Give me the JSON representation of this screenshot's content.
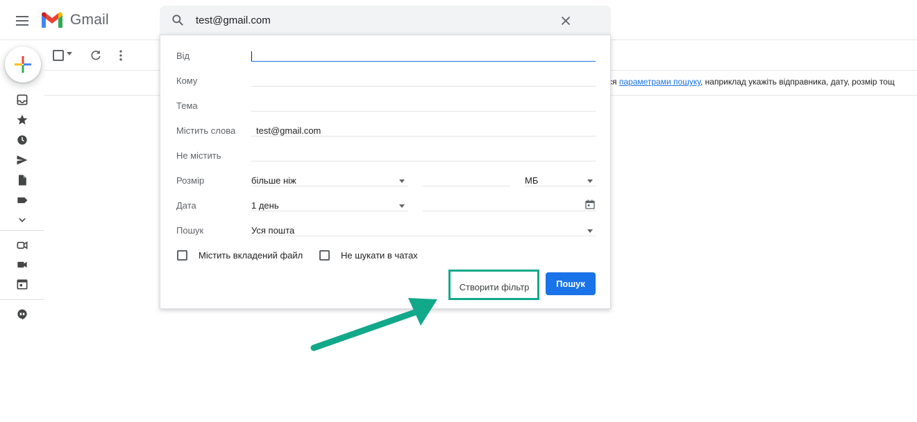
{
  "app": {
    "name": "Gmail"
  },
  "search": {
    "query": "test@gmail.com"
  },
  "info_row": {
    "prefix": "ся ",
    "link_text": "параметрами пошуку",
    "suffix": ", наприклад укажіть відправника, дату, розмір тощ"
  },
  "advanced_search": {
    "fields": {
      "from_label": "Від",
      "to_label": "Кому",
      "subject_label": "Тема",
      "has_words_label": "Містить слова",
      "has_words_value": "test@gmail.com",
      "not_has_label": "Не містить",
      "size_label": "Розмір",
      "size_operator": "більше ніж",
      "size_unit": "МБ",
      "date_label": "Дата",
      "date_range": "1 день",
      "search_in_label": "Пошук",
      "search_in_value": "Уся пошта"
    },
    "checkboxes": {
      "has_attachment": "Містить вкладений файл",
      "exclude_chats": "Не шукати в чатах"
    },
    "buttons": {
      "create_filter": "Створити фільтр",
      "search": "Пошук"
    }
  },
  "colors": {
    "accent": "#1a73e8",
    "highlight": "#12a88a",
    "arrow": "#12a88a"
  },
  "icons": {
    "rail": [
      "inbox-icon",
      "star-icon",
      "clock-icon",
      "send-icon",
      "file-icon",
      "label-icon",
      "chevron-down-icon",
      "meet-new-icon",
      "video-icon",
      "calendar-icon",
      "hangouts-icon"
    ]
  }
}
